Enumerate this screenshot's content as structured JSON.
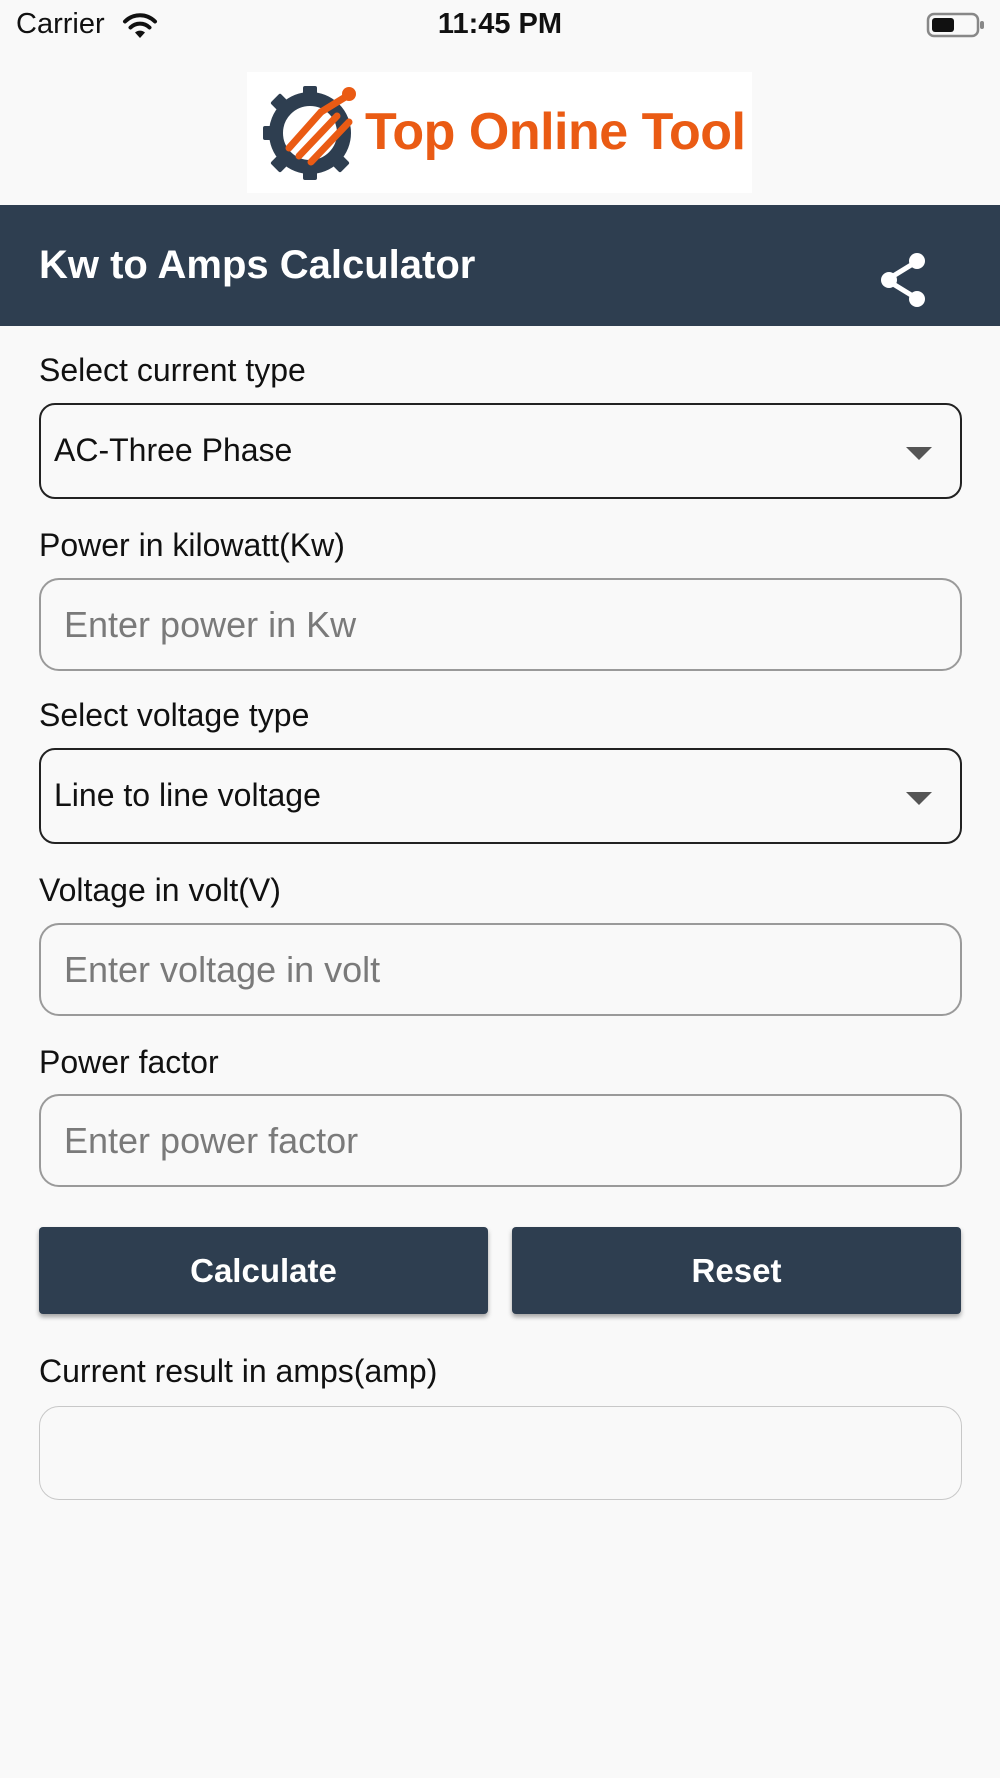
{
  "status_bar": {
    "carrier": "Carrier",
    "time": "11:45 PM",
    "wifi_icon": "wifi-icon",
    "battery_icon": "battery-icon"
  },
  "logo": {
    "text": "Top Online Tool",
    "brand_color": "#ea5b14",
    "mark_color": "#2e3e50"
  },
  "app_bar": {
    "title": "Kw to Amps Calculator",
    "background": "#2e3e50",
    "share_icon": "share-icon"
  },
  "form": {
    "current_type": {
      "label": "Select current type",
      "value": "AC-Three Phase",
      "caret_icon": "caret-down-icon"
    },
    "power": {
      "label": "Power in kilowatt(Kw)",
      "value": "",
      "placeholder": "Enter power in Kw"
    },
    "voltage_type": {
      "label": "Select voltage type",
      "value": "Line to line voltage",
      "caret_icon": "caret-down-icon"
    },
    "voltage": {
      "label": "Voltage in volt(V)",
      "value": "",
      "placeholder": "Enter voltage in volt"
    },
    "power_factor": {
      "label": "Power factor",
      "value": "",
      "placeholder": "Enter power factor"
    }
  },
  "actions": {
    "calculate_label": "Calculate",
    "reset_label": "Reset"
  },
  "result": {
    "label": "Current result in amps(amp)",
    "value": ""
  }
}
